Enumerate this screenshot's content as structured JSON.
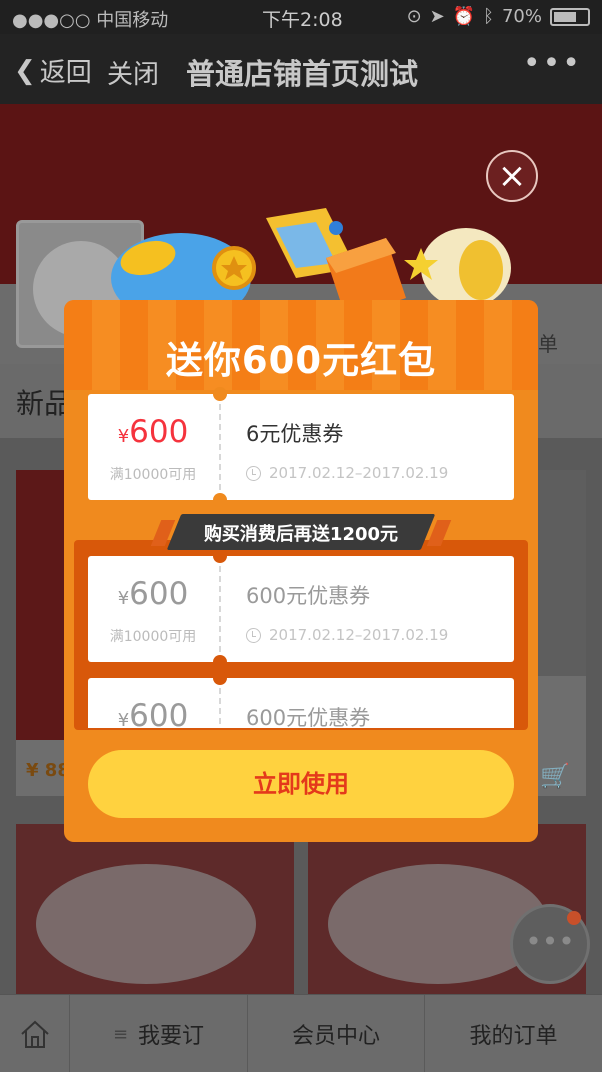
{
  "status_bar": {
    "carrier": "●●●○○ 中国移动",
    "time": "下午2:08",
    "battery": "70%",
    "battery_level": 0.7
  },
  "nav": {
    "back": "返回",
    "close": "关闭",
    "title": "普通店铺首页测试",
    "more": "•••"
  },
  "page": {
    "strip_right_text": "单",
    "section_title": "新品",
    "price_partial": "¥ 88"
  },
  "tabbar": {
    "tab1": "我要订",
    "tab2": "会员中心",
    "tab3": "我的订单"
  },
  "modal": {
    "title": "送你600元红包",
    "bonus_text": "购买消费后再送1200元",
    "coupons": [
      {
        "amount": "600",
        "yen": "¥",
        "condition": "满10000可用",
        "name": "6元优惠券",
        "date": "2017.02.12–2017.02.19"
      },
      {
        "amount": "600",
        "yen": "¥",
        "condition": "满10000可用",
        "name": "600元优惠券",
        "date": "2017.02.12–2017.02.19"
      },
      {
        "amount": "600",
        "yen": "¥",
        "name": "600元优惠券"
      }
    ],
    "button": "立即使用",
    "close_glyph": "×"
  },
  "colors": {
    "accent_orange": "#f08a1e",
    "price_red": "#f5333d",
    "button_yellow": "#ffd23f"
  }
}
